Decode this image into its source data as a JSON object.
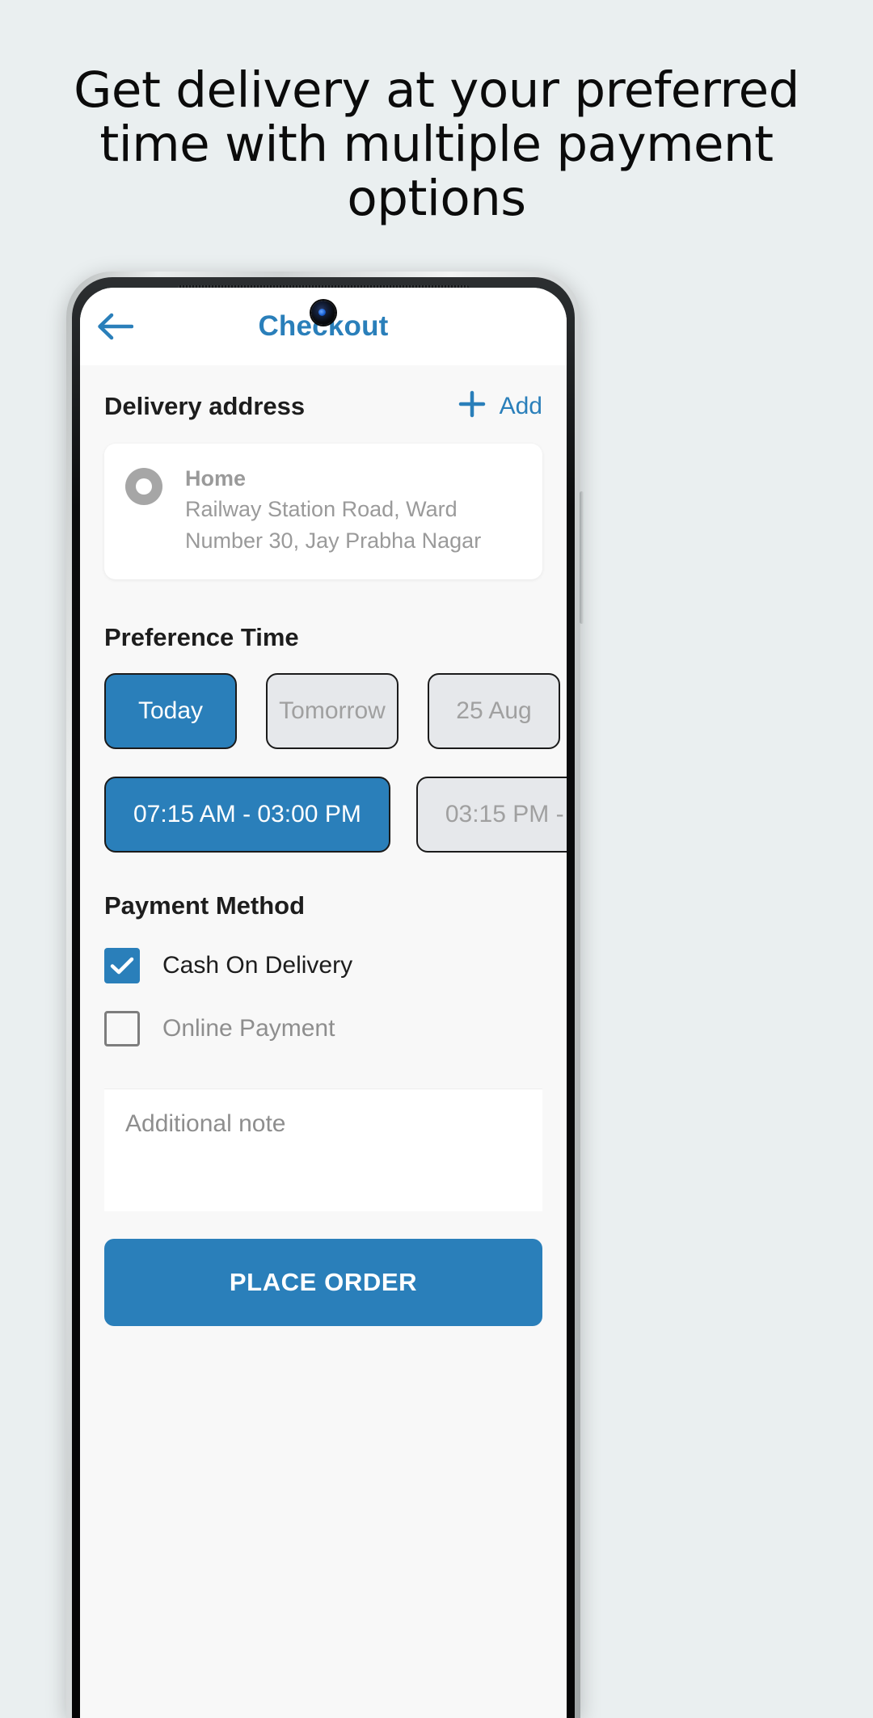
{
  "promo": {
    "headline": "Get delivery at your preferred time with multiple payment options"
  },
  "colors": {
    "background": "#eaeff0",
    "accent": "#2a7fba",
    "screen_bg": "#f8f8f8",
    "card_bg": "#ffffff",
    "muted_text": "#9a9a9a",
    "chip_inactive_bg": "#e6e8eb"
  },
  "appbar": {
    "back_icon": "arrow-left-icon",
    "title": "Checkout"
  },
  "delivery_address": {
    "section_title": "Delivery address",
    "add_icon": "plus-icon",
    "add_label": "Add",
    "selected_index": 0,
    "items": [
      {
        "name": "Home",
        "detail": "Railway Station Road, Ward Number 30, Jay Prabha Nagar",
        "selected": false
      }
    ]
  },
  "preference_time": {
    "section_title": "Preference Time",
    "dates": [
      {
        "label": "Today",
        "selected": true
      },
      {
        "label": "Tomorrow",
        "selected": false
      },
      {
        "label": "25 Aug",
        "selected": false
      }
    ],
    "slots": [
      {
        "label": "07:15 AM - 03:00 PM",
        "selected": true
      },
      {
        "label": "03:15 PM -",
        "selected": false
      }
    ]
  },
  "payment_method": {
    "section_title": "Payment Method",
    "options": [
      {
        "label": "Cash On Delivery",
        "checked": true,
        "icon": "checkbox-checked-icon"
      },
      {
        "label": "Online Payment",
        "checked": false,
        "icon": "checkbox-unchecked-icon"
      }
    ]
  },
  "note": {
    "placeholder": "Additional note",
    "value": ""
  },
  "footer": {
    "place_order_label": "PLACE ORDER"
  }
}
